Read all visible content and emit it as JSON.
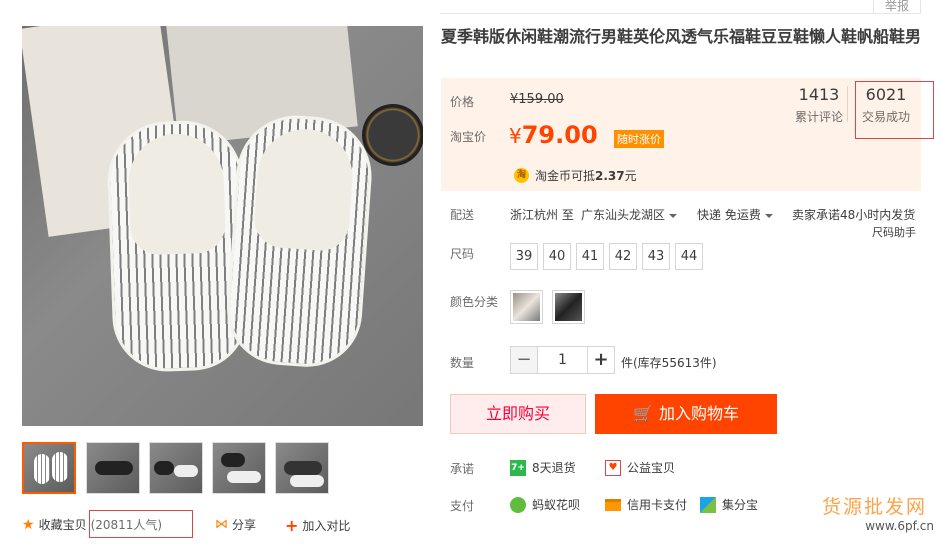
{
  "header": {
    "report_label": "举报"
  },
  "product": {
    "title": "夏季韩版休闲鞋潮流行男鞋英伦风透气乐福鞋豆豆鞋懒人鞋帆船鞋男"
  },
  "price": {
    "price_label": "价格",
    "original": "¥159.00",
    "promo_label": "淘宝价",
    "current_symbol": "¥",
    "current": "79.00",
    "promo_tag": "随时涨价",
    "coin_icon": "淘",
    "coin_text": "淘金币可抵",
    "coin_amount": "2.37",
    "coin_unit": "元"
  },
  "stats": {
    "reviews_count": "1413",
    "reviews_label": "累计评论",
    "sales_count": "6021",
    "sales_label": "交易成功"
  },
  "delivery": {
    "label": "配送",
    "from": "浙江杭州 至",
    "to": "广东汕头龙湖区",
    "shipping": "快递 免运费",
    "promise": "卖家承诺48小时内发货",
    "size_helper": "尺码助手"
  },
  "sizes": {
    "label": "尺码",
    "options": [
      "39",
      "40",
      "41",
      "42",
      "43",
      "44"
    ]
  },
  "colors": {
    "label": "颜色分类"
  },
  "quantity": {
    "label": "数量",
    "minus": "−",
    "value": "1",
    "plus": "+",
    "stock": "件(库存55613件)"
  },
  "buttons": {
    "buy_now": "立即购买",
    "add_to_cart": "加入购物车"
  },
  "promise": {
    "label": "承诺",
    "return_icon": "7+",
    "return_text": "8天退货",
    "charity_text": "公益宝贝"
  },
  "payment": {
    "label": "支付",
    "huabei": "蚂蚁花呗",
    "credit_card": "信用卡支付",
    "jifen": "集分宝"
  },
  "gallery_actions": {
    "favorite": "收藏宝贝",
    "popularity": "(20811人气)",
    "share": "分享",
    "compare": "加入对比"
  },
  "watermark": {
    "text": "货源批发网",
    "url": "www.6pf.cn"
  },
  "colors_theme": {
    "accent": "#ff4400",
    "promo": "#ff9000",
    "highlight_box": "#d94848"
  }
}
